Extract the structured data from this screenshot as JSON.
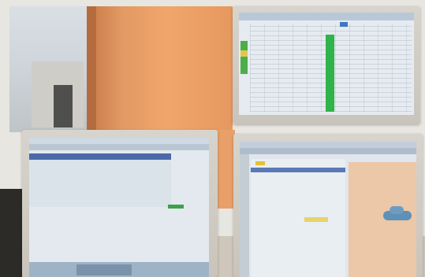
{
  "scene": {
    "description_colors": {
      "partition": "#f0a66b",
      "bezel": "#d7d4cd",
      "screen": "#e3e9ef",
      "accent_green": "#2fb34a",
      "accent_blue": "#4c68a8",
      "accent_yellow": "#e2c233"
    }
  },
  "monitors": [
    {
      "position": "top-right"
    },
    {
      "position": "bottom-left"
    },
    {
      "position": "bottom-right"
    }
  ]
}
